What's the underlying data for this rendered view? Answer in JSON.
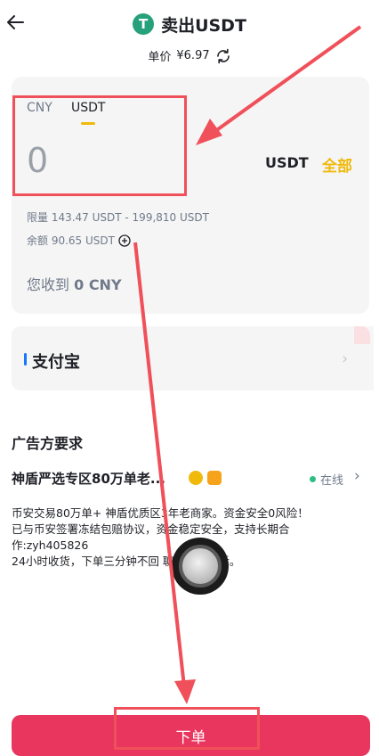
{
  "header": {
    "title": "卖出USDT",
    "coin_symbol": "T",
    "price_label": "单价",
    "price_value": "¥6.97"
  },
  "card": {
    "tabs": [
      "CNY",
      "USDT"
    ],
    "active_tab": "USDT",
    "amount": "0",
    "unit": "USDT",
    "all_label": "全部",
    "limit_text": "限量 143.47 USDT - 199,810 USDT",
    "balance_text": "余额 90.65 USDT",
    "receive_label": "您收到",
    "receive_value": "0 CNY"
  },
  "payment": {
    "label": "支付宝"
  },
  "advertiser": {
    "section_title": "广告方要求",
    "name": "神盾严选专区80万单老...",
    "status": "在线",
    "desc_lines": [
      "币安交易80万单+  神盾优质区3年老商家。资金安全0风险！",
      "已与币安签署冻结包赔协议，资金稳定安全，支持长期合",
      "作:zyh405826",
      "24小时收货，下单三分钟不回    聊天窗口电话。"
    ]
  },
  "footer": {
    "order_label": "下单"
  },
  "colors": {
    "accent": "#f0b90b",
    "order_button": "#e8365f",
    "annotation_red": "#f0505a",
    "online_green": "#2ebd85",
    "tether_green": "#26a17b"
  }
}
